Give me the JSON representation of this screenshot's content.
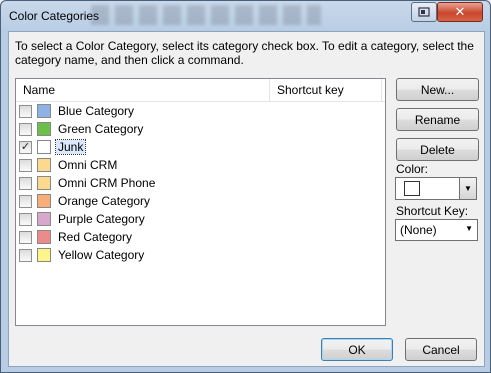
{
  "window": {
    "title": "Color Categories"
  },
  "titlebar": {
    "help_icon": "help-icon",
    "close_icon": "close-icon",
    "close_glyph": "✕"
  },
  "instructions": "To select a Color Category, select its category check box.  To edit a category, select the category name, and then click a command.",
  "list": {
    "columns": {
      "name": "Name",
      "shortcut": "Shortcut key"
    },
    "items": [
      {
        "label": "Blue Category",
        "color": "#8eb1e6",
        "checked": false,
        "shortcut": ""
      },
      {
        "label": "Green Category",
        "color": "#6cc04a",
        "checked": false,
        "shortcut": ""
      },
      {
        "label": "Junk",
        "color": "#ffffff",
        "checked": true,
        "shortcut": "",
        "selected": true
      },
      {
        "label": "Omni CRM",
        "color": "#fcd98e",
        "checked": false,
        "shortcut": ""
      },
      {
        "label": "Omni CRM Phone",
        "color": "#fcd98e",
        "checked": false,
        "shortcut": ""
      },
      {
        "label": "Orange Category",
        "color": "#f9ae7a",
        "checked": false,
        "shortcut": ""
      },
      {
        "label": "Purple Category",
        "color": "#d8a7cc",
        "checked": false,
        "shortcut": ""
      },
      {
        "label": "Red Category",
        "color": "#ec8b8b",
        "checked": false,
        "shortcut": ""
      },
      {
        "label": "Yellow Category",
        "color": "#fbf58a",
        "checked": false,
        "shortcut": ""
      }
    ]
  },
  "buttons": {
    "new": "New...",
    "rename": "Rename",
    "delete": "Delete",
    "ok": "OK",
    "cancel": "Cancel"
  },
  "color": {
    "label": "Color:",
    "value": "#ffffff"
  },
  "shortcut_key": {
    "label": "Shortcut Key:",
    "value": "(None)"
  }
}
